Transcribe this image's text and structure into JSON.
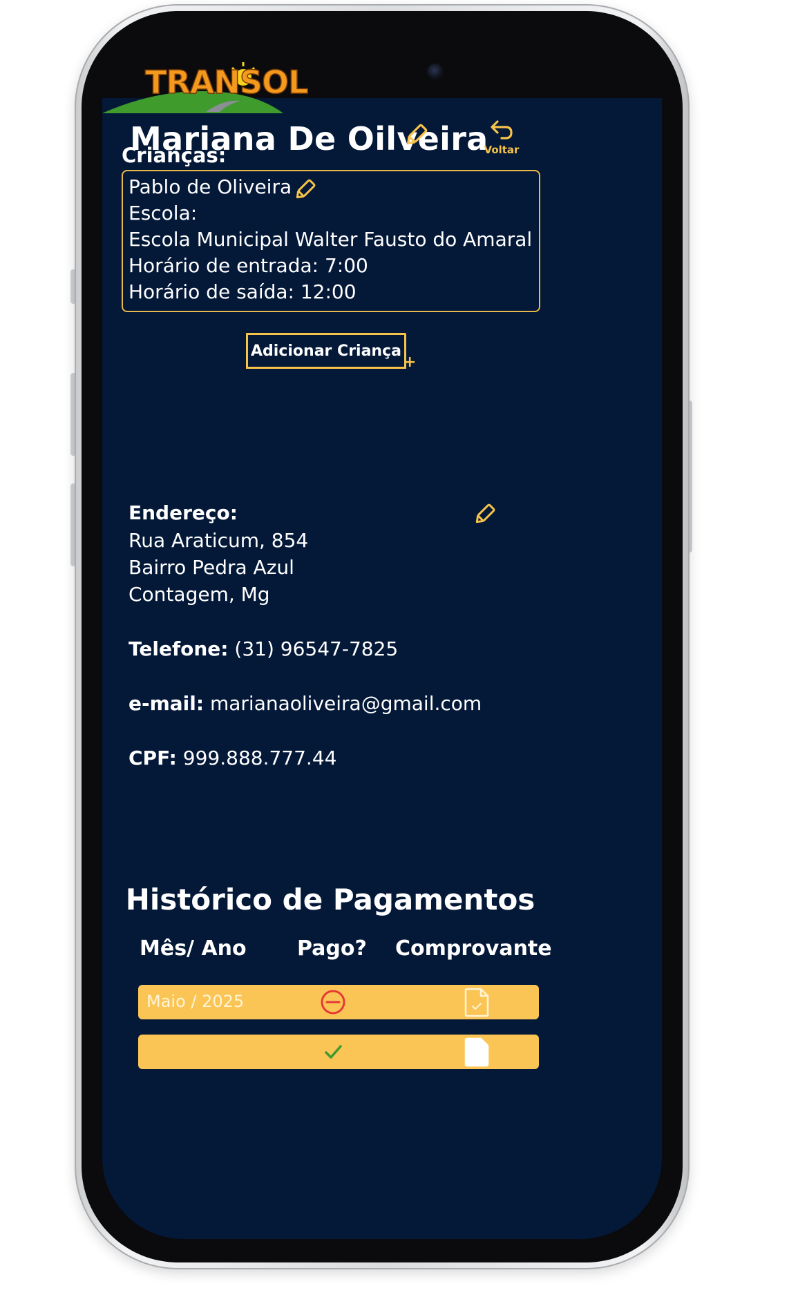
{
  "app": {
    "logo_text": "TRANSOL"
  },
  "header": {
    "title": "Mariana De Oilveira",
    "back_label": "Voltar"
  },
  "children": {
    "label": "Crianças:",
    "items": [
      {
        "name": "Pablo de Oliveira",
        "school_label": "Escola:",
        "school": "Escola Municipal Walter Fausto do Amaral",
        "entry": "Horário de entrada: 7:00",
        "exit": "Horário de saída: 12:00"
      }
    ],
    "add_label": "Adicionar Criança",
    "add_plus": "+"
  },
  "address": {
    "label": "Endereço:",
    "line1": "Rua Araticum, 854",
    "line2": "Bairro Pedra Azul",
    "line3": "Contagem, Mg"
  },
  "contact": {
    "phone_label": "Telefone:",
    "phone": "(31) 96547-7825",
    "email_label": "e-mail:",
    "email": "marianaoliveira@gmail.com",
    "cpf_label": "CPF:",
    "cpf": "999.888.777.44"
  },
  "payments": {
    "title": "Histórico de Pagamentos",
    "columns": [
      "Mês/ Ano",
      "Pago?",
      "Comprovante"
    ],
    "rows": [
      {
        "month": "Maio / 2025",
        "paid": false,
        "status_icon": "minus-circle-icon",
        "receipt_icon": "document-icon"
      },
      {
        "month": "",
        "paid": true,
        "status_icon": "check-icon",
        "receipt_icon": "document-icon"
      }
    ]
  },
  "colors": {
    "background": "#041838",
    "accent": "#f6c24a",
    "row": "#fbc556",
    "unpaid": "#e53935"
  }
}
